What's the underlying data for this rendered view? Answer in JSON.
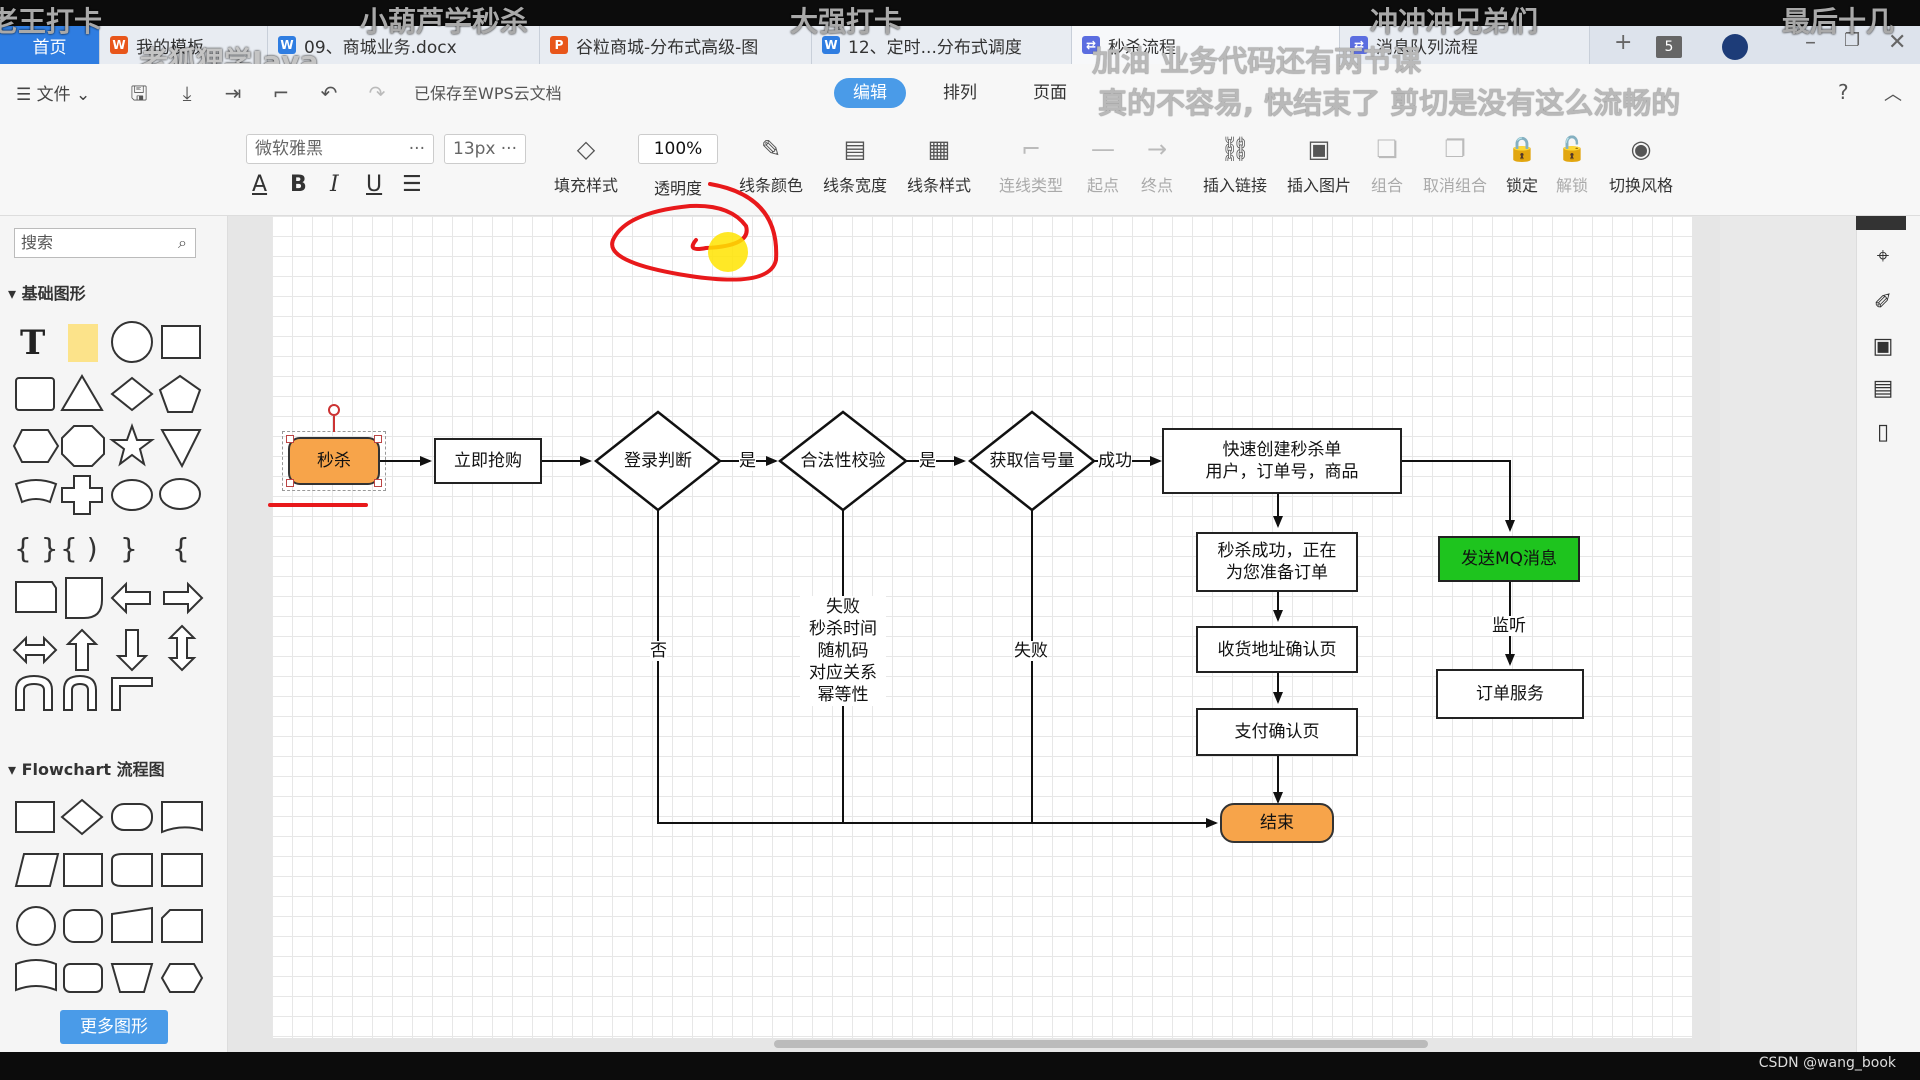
{
  "overlay": {
    "texts": [
      "老王打卡",
      "小葫芦学秒杀",
      "大强打卡",
      "冲冲冲兄弟们",
      "最后十几",
      "老狐狸学Java"
    ],
    "subtitle_line1": "加油   业务代码还有两节课",
    "subtitle_line2": "真的不容易, 快结束了     剪切是没有这么流畅的"
  },
  "tabs": [
    {
      "label": "首页"
    },
    {
      "label": "我的模板",
      "icon": "wps-icon",
      "color": "#e8561b"
    },
    {
      "label": "09、商城业务.docx",
      "icon": "word-icon",
      "color": "#2f7de1"
    },
    {
      "label": "谷粒商城-分布式高级-图",
      "icon": "ppt-icon",
      "color": "#e8561b"
    },
    {
      "label": "12、定时...分布式调度",
      "icon": "word-icon",
      "color": "#2f7de1"
    },
    {
      "label": "秒杀流程",
      "icon": "flowchart-icon",
      "color": "#5b6de0"
    },
    {
      "label": "消息队列流程",
      "icon": "flowchart-icon",
      "color": "#5b6de0"
    }
  ],
  "tab_count": "5",
  "menu": {
    "file": "文件",
    "saved_status": "已保存至WPS云文档",
    "context_tabs": [
      "编辑",
      "排列",
      "页面"
    ],
    "help": "?"
  },
  "ribbon": {
    "font_family": "微软雅黑",
    "font_size": "13px",
    "opacity_value": "100%",
    "buttons": [
      "填充样式",
      "透明度",
      "线条颜色",
      "线条宽度",
      "线条样式",
      "连线类型",
      "起点",
      "终点",
      "插入链接",
      "插入图片",
      "组合",
      "取消组合",
      "锁定",
      "解锁",
      "切换风格"
    ]
  },
  "left_panel": {
    "search_placeholder": "搜索",
    "section_basic": "基础图形",
    "section_flowchart": "Flowchart 流程图",
    "more_shapes": "更多图形"
  },
  "diagram": {
    "start": "秒杀",
    "buy_now": "立即抢购",
    "login_check": "登录判断",
    "validity_check": "合法性校验",
    "get_semaphore": "获取信号量",
    "create_order_line1": "快速创建秒杀单",
    "create_order_line2": "用户，订单号，商品",
    "success_line1": "秒杀成功，正在",
    "success_line2": "为您准备订单",
    "address_confirm": "收货地址确认页",
    "payment_confirm": "支付确认页",
    "end": "结束",
    "send_mq": "发送MQ消息",
    "order_service": "订单服务",
    "edge_yes1": "是",
    "edge_yes2": "是",
    "edge_success": "成功",
    "edge_no": "否",
    "edge_fail": "失败",
    "edge_listen": "监听",
    "fail_note": [
      "失败",
      "秒杀时间",
      "随机码",
      "对应关系",
      "幂等性"
    ],
    "colors": {
      "start_end": "#f7a44a",
      "mq": "#1ec41e",
      "annotation": "#e8191b"
    }
  },
  "watermark": "CSDN @wang_book"
}
